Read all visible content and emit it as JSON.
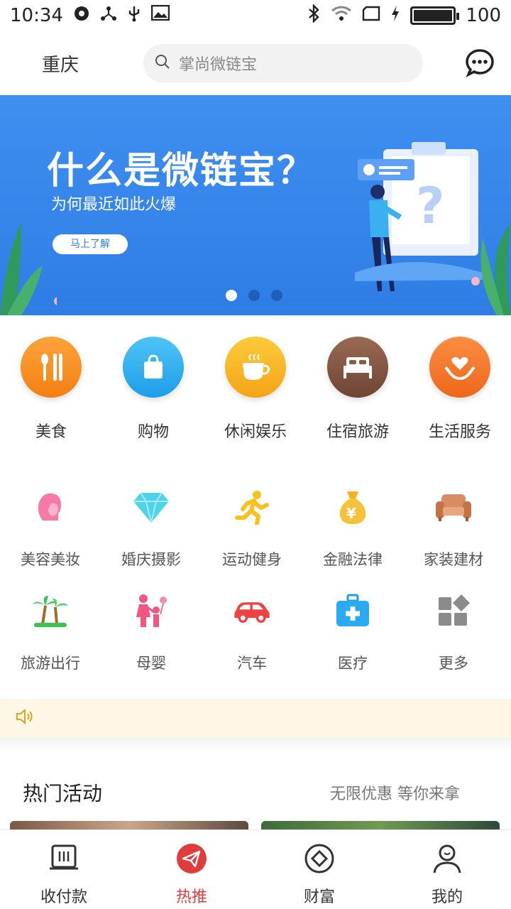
{
  "status_bar": {
    "time": "10:34",
    "battery": "100",
    "battery_level": 1.0
  },
  "header": {
    "city": "重庆",
    "search_placeholder": "掌尚微链宝",
    "chat_icon": "chat-bubble-icon"
  },
  "banner": {
    "title": "什么是微链宝？",
    "subtitle": "为何最近如此火爆",
    "button_label": "马上了解",
    "slide_count": 3,
    "active_slide": 0
  },
  "primary_categories": [
    {
      "label": "美食",
      "icon": "cutlery-icon",
      "color": "#f98d1e"
    },
    {
      "label": "购物",
      "icon": "shopping-bag-icon",
      "color": "#29a9ee"
    },
    {
      "label": "休闲娱乐",
      "icon": "coffee-cup-icon",
      "color": "#f6b51f"
    },
    {
      "label": "住宿旅游",
      "icon": "bed-icon",
      "color": "#8a5b45"
    },
    {
      "label": "生活服务",
      "icon": "heart-hands-icon",
      "color": "#f57a2c"
    }
  ],
  "secondary_categories": [
    {
      "label": "美容美妆",
      "icon": "woman-profile-icon"
    },
    {
      "label": "婚庆摄影",
      "icon": "diamond-icon"
    },
    {
      "label": "运动健身",
      "icon": "runner-icon"
    },
    {
      "label": "金融法律",
      "icon": "money-bag-icon"
    },
    {
      "label": "家装建材",
      "icon": "sofa-icon"
    },
    {
      "label": "旅游出行",
      "icon": "palm-trees-icon"
    },
    {
      "label": "母婴",
      "icon": "mother-child-icon"
    },
    {
      "label": "汽车",
      "icon": "car-icon"
    },
    {
      "label": "医疗",
      "icon": "medical-kit-icon"
    },
    {
      "label": "更多",
      "icon": "more-grid-icon"
    }
  ],
  "notice": {
    "icon": "speaker-icon"
  },
  "hot": {
    "title": "热门活动",
    "subtitle": "无限优惠 等你来拿"
  },
  "bottom_nav": [
    {
      "label": "收付款",
      "icon": "register-icon",
      "active": false
    },
    {
      "label": "热推",
      "icon": "paper-plane-icon",
      "active": true
    },
    {
      "label": "财富",
      "icon": "diamond-outline-icon",
      "active": false
    },
    {
      "label": "我的",
      "icon": "user-icon",
      "active": false
    }
  ],
  "colors": {
    "active_red": "#e03c3c",
    "banner_blue": "#3f8ff0",
    "notice_bg": "#fdf8e6"
  }
}
